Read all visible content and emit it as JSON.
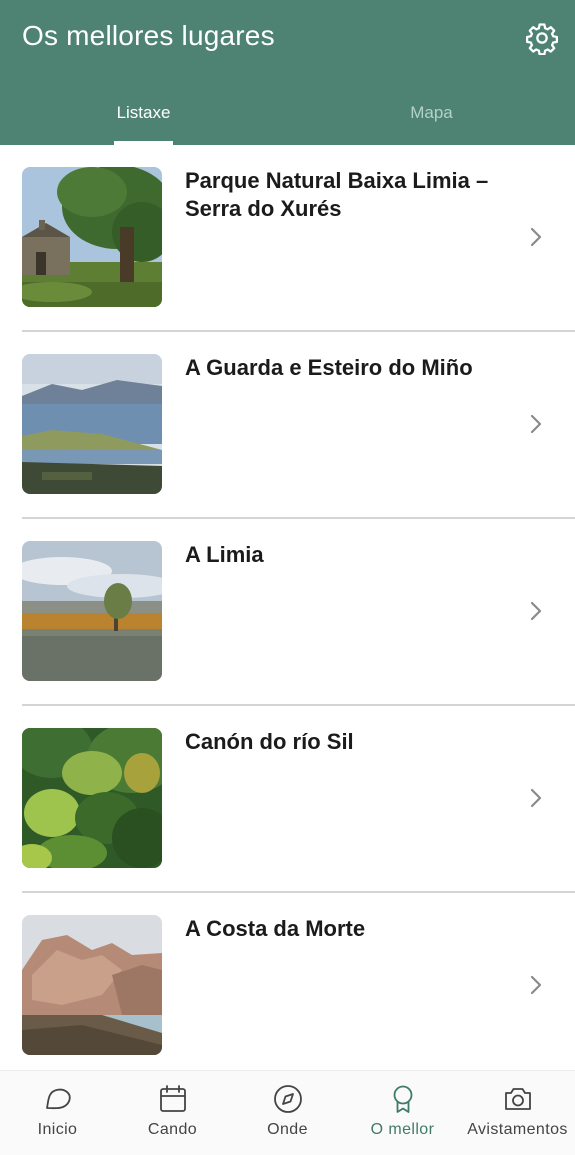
{
  "header": {
    "title": "Os mellores lugares",
    "settings_icon": "gear-icon"
  },
  "tabs": [
    {
      "label": "Listaxe",
      "active": true
    },
    {
      "label": "Mapa",
      "active": false
    }
  ],
  "places": [
    {
      "title": "Parque Natural Baixa Limia – Serra do Xurés",
      "image": "chapel-and-oak-tree"
    },
    {
      "title": "A Guarda e Esteiro do Miño",
      "image": "river-estuary"
    },
    {
      "title": "A Limia",
      "image": "wetland-lagoon"
    },
    {
      "title": "Canón do río Sil",
      "image": "green-forest-canyon"
    },
    {
      "title": "A Costa da Morte",
      "image": "coastal-rocks"
    }
  ],
  "bottom_nav": [
    {
      "label": "Inicio",
      "icon": "chat-bubble-icon",
      "active": false
    },
    {
      "label": "Cando",
      "icon": "calendar-icon",
      "active": false
    },
    {
      "label": "Onde",
      "icon": "compass-icon",
      "active": false
    },
    {
      "label": "O mellor",
      "icon": "award-ribbon-icon",
      "active": true
    },
    {
      "label": "Avistamentos",
      "icon": "camera-icon",
      "active": false
    }
  ],
  "colors": {
    "header": "#4e8373",
    "active_nav": "#3f7a68",
    "inactive_tab": "#b3d2c7"
  }
}
